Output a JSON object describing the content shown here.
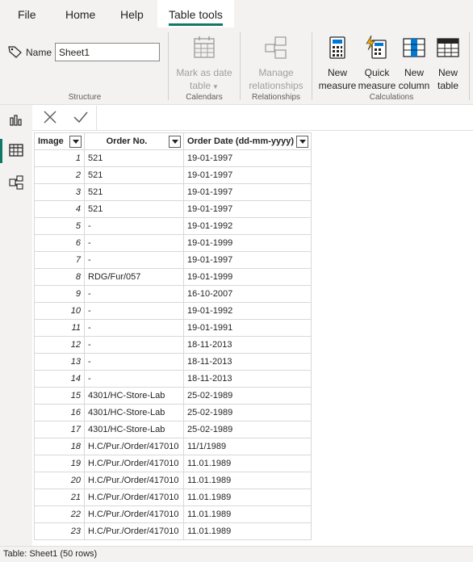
{
  "tabs": [
    {
      "label": "File",
      "active": false
    },
    {
      "label": "Home",
      "active": false
    },
    {
      "label": "Help",
      "active": false
    },
    {
      "label": "Table tools",
      "active": true
    }
  ],
  "ribbon": {
    "name_label": "Name",
    "name_value": "Sheet1",
    "structure_label": "Structure",
    "mark_as_date": {
      "line1": "Mark as date",
      "line2": "table"
    },
    "calendars_label": "Calendars",
    "manage_relationships": {
      "line1": "Manage",
      "line2": "relationships"
    },
    "relationships_label": "Relationships",
    "new_measure": {
      "line1": "New",
      "line2": "measure"
    },
    "quick_measure": {
      "line1": "Quick",
      "line2": "measure"
    },
    "new_column": {
      "line1": "New",
      "line2": "column"
    },
    "new_table": {
      "line1": "New",
      "line2": "table"
    },
    "calculations_label": "Calculations"
  },
  "rail": {
    "items": [
      {
        "icon": "report-view-icon",
        "active": false
      },
      {
        "icon": "table-view-icon",
        "active": true
      },
      {
        "icon": "model-view-icon",
        "active": false
      }
    ]
  },
  "table": {
    "headers": [
      "Image",
      "Order No.",
      "Order Date (dd-mm-yyyy)"
    ],
    "rows": [
      [
        "1",
        "521",
        "19-01-1997"
      ],
      [
        "2",
        "521",
        "19-01-1997"
      ],
      [
        "3",
        "521",
        "19-01-1997"
      ],
      [
        "4",
        "521",
        "19-01-1997"
      ],
      [
        "5",
        "-",
        "19-01-1992"
      ],
      [
        "6",
        "-",
        "19-01-1999"
      ],
      [
        "7",
        "-",
        "19-01-1997"
      ],
      [
        "8",
        "RDG/Fur/057",
        "19-01-1999"
      ],
      [
        "9",
        "-",
        "16-10-2007"
      ],
      [
        "10",
        "-",
        "19-01-1992"
      ],
      [
        "11",
        "-",
        "19-01-1991"
      ],
      [
        "12",
        "-",
        "18-11-2013"
      ],
      [
        "13",
        "-",
        "18-11-2013"
      ],
      [
        "14",
        "-",
        "18-11-2013"
      ],
      [
        "15",
        "4301/HC-Store-Lab",
        "25-02-1989"
      ],
      [
        "16",
        "4301/HC-Store-Lab",
        "25-02-1989"
      ],
      [
        "17",
        "4301/HC-Store-Lab",
        "25-02-1989"
      ],
      [
        "18",
        "H.C/Pur./Order/417010",
        "11/1/1989"
      ],
      [
        "19",
        "H.C/Pur./Order/417010",
        "11.01.1989"
      ],
      [
        "20",
        "H.C/Pur./Order/417010",
        "11.01.1989"
      ],
      [
        "21",
        "H.C/Pur./Order/417010",
        "11.01.1989"
      ],
      [
        "22",
        "H.C/Pur./Order/417010",
        "11.01.1989"
      ],
      [
        "23",
        "H.C/Pur./Order/417010",
        "11.01.1989"
      ]
    ]
  },
  "status": {
    "text": "Table: Sheet1 (50 rows)"
  },
  "colors": {
    "accent": "#117865",
    "ribbon_bg": "#f3f2f1",
    "blue_icon": "#0078d4",
    "bolt": "#f2a900"
  }
}
